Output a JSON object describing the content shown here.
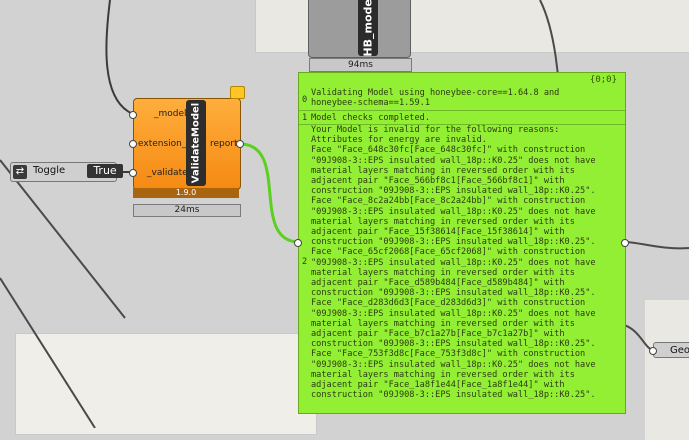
{
  "canvas": {
    "bg": "#d2d2d2",
    "accent_orange": "#f7961f",
    "panel_green": "#93ef33"
  },
  "hb_model": {
    "label": "HB_model",
    "timing": "94ms"
  },
  "validate": {
    "name": "ValidateModel",
    "inputs": [
      "_model",
      "extension_",
      "_validate"
    ],
    "output": "report",
    "version": "1.9.0",
    "timing": "24ms"
  },
  "toggle": {
    "icon": "toggle-icon",
    "label": "Toggle",
    "value": "True"
  },
  "panel": {
    "index": "{0;0}",
    "branch0_idx": "0",
    "branch0_text": "Validating Model using honeybee-core==1.64.8 and\nhoneybee-schema==1.59.1",
    "branch1_idx": "1",
    "branch1_text": "Model checks completed.",
    "branch2_idx": "2",
    "branch2_text": "Your Model is invalid for the following reasons:\nAttributes for energy are invalid.\nFace \"Face_648c30fc[Face_648c30fc]\" with construction\n\"09J908-3::EPS insulated wall_18p::K0.25\" does not have\nmaterial layers matching in reversed order with its\nadjacent pair \"Face_566bf8c1[Face_566bf8c1]\" with\nconstruction \"09J908-3::EPS insulated wall_18p::K0.25\".\nFace \"Face_8c2a24bb[Face_8c2a24bb]\" with construction\n\"09J908-3::EPS insulated wall_18p::K0.25\" does not have\nmaterial layers matching in reversed order with its\nadjacent pair \"Face_15f38614[Face_15f38614]\" with\nconstruction \"09J908-3::EPS insulated wall_18p::K0.25\".\nFace \"Face_65cf2068[Face_65cf2068]\" with construction\n\"09J908-3::EPS insulated wall_18p::K0.25\" does not have\nmaterial layers matching in reversed order with its\nadjacent pair \"Face_d589b484[Face_d589b484]\" with\nconstruction \"09J908-3::EPS insulated wall_18p::K0.25\".\nFace \"Face_d283d6d3[Face_d283d6d3]\" with construction\n\"09J908-3::EPS insulated wall_18p::K0.25\" does not have\nmaterial layers matching in reversed order with its\nadjacent pair \"Face_b7c1a27b[Face_b7c1a27b]\" with\nconstruction \"09J908-3::EPS insulated wall_18p::K0.25\".\nFace \"Face_753f3d8c[Face_753f3d8c]\" with construction\n\"09J908-3::EPS insulated wall_18p::K0.25\" does not have\nmaterial layers matching in reversed order with its\nadjacent pair \"Face_1a8f1e44[Face_1a8f1e44]\" with\nconstruction \"09J908-3::EPS insulated wall_18p::K0.25\"."
  },
  "geo": {
    "label": "Geo"
  }
}
